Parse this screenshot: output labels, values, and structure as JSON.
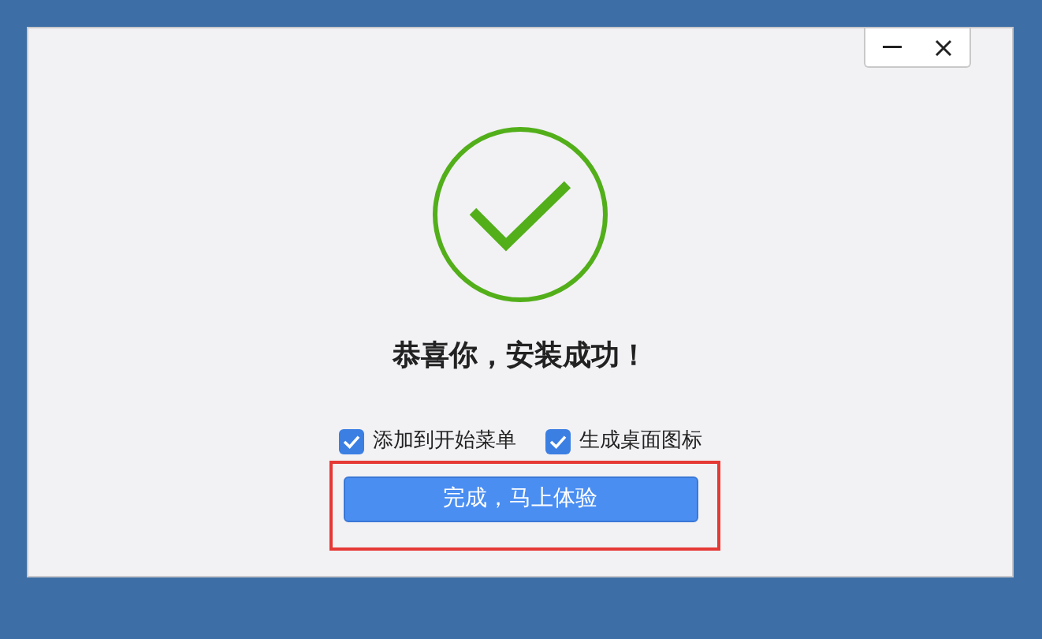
{
  "window": {
    "buttons": [
      {
        "kind": "minimize"
      },
      {
        "kind": "close"
      }
    ]
  },
  "title": "恭喜你，安装成功！",
  "options": [
    {
      "label": "添加到开始菜单",
      "checked": true
    },
    {
      "label": "生成桌面图标",
      "checked": true
    }
  ],
  "primary_button": "完成，马上体验"
}
